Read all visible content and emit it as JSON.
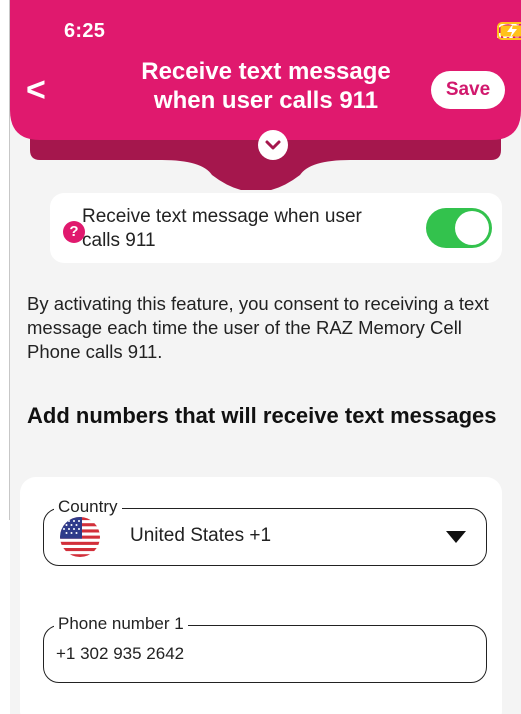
{
  "status_bar": {
    "time": "6:25"
  },
  "header": {
    "back_glyph": "<",
    "title": "Receive text message when user calls 911",
    "save_label": "Save",
    "color": "#e0196e",
    "dark_color": "#a5174d"
  },
  "setting": {
    "label": "Receive text message when user calls 911",
    "help_glyph": "?",
    "enabled": true,
    "toggle_color": "#33c24d"
  },
  "consent_text": "By activating this feature, you consent to receiving a text message each time the user of the RAZ Memory Cell Phone calls 911.",
  "section_title": "Add numbers that will receive text messages",
  "form": {
    "country": {
      "label": "Country",
      "value": "United States +1",
      "flag_icon": "us-flag-icon"
    },
    "phone_1": {
      "label": "Phone number 1",
      "value": "+1  302 935 2642"
    }
  }
}
